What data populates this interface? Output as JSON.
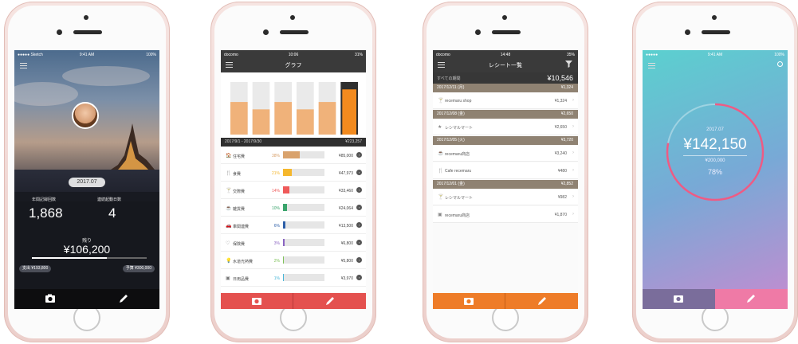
{
  "phones": [
    {
      "status": {
        "carrier": "●●●●● Sketch",
        "time": "9:41 AM",
        "battery": "100%"
      },
      "date": "2017.07",
      "stat_labels": [
        "年間記録回数",
        "連続起動日数"
      ],
      "stat_values": [
        "1,868",
        "4"
      ],
      "remaining_label": "残り",
      "remaining_value": "¥106,200",
      "spend_progress": 0.65,
      "spent_chip": "支出 ¥193,800",
      "budget_chip": "予算 ¥300,000"
    },
    {
      "status": {
        "carrier": "docomo",
        "time": "10:06",
        "battery": "31%"
      },
      "title": "グラフ",
      "bar_levels": [
        0.62,
        0.48,
        0.62,
        0.48,
        0.62,
        0.86
      ],
      "range_label": "2017/9/1 - 2017/9/30",
      "range_total": "¥223,257",
      "categories": [
        {
          "icon": "🏠",
          "name": "住宅費",
          "pct": "38%",
          "ratio": 0.38,
          "color": "#d9a26c",
          "amount": "¥85,000"
        },
        {
          "icon": "🍴",
          "name": "食費",
          "pct": "21%",
          "ratio": 0.21,
          "color": "#f5b72d",
          "amount": "¥47,973"
        },
        {
          "icon": "🍸",
          "name": "交際費",
          "pct": "14%",
          "ratio": 0.14,
          "color": "#ef5a5a",
          "amount": "¥33,460"
        },
        {
          "icon": "☕",
          "name": "雑貨費",
          "pct": "10%",
          "ratio": 0.1,
          "color": "#3aa46c",
          "amount": "¥24,064"
        },
        {
          "icon": "🚗",
          "name": "車関連費",
          "pct": "6%",
          "ratio": 0.06,
          "color": "#2e5fa8",
          "amount": "¥13,500"
        },
        {
          "icon": "♡",
          "name": "保険費",
          "pct": "3%",
          "ratio": 0.03,
          "color": "#8a64c2",
          "amount": "¥6,800"
        },
        {
          "icon": "💡",
          "name": "水道光熱費",
          "pct": "2%",
          "ratio": 0.02,
          "color": "#7fc25a",
          "amount": "¥5,800"
        },
        {
          "icon": "▣",
          "name": "日用品費",
          "pct": "1%",
          "ratio": 0.01,
          "color": "#48b6d8",
          "amount": "¥3,970"
        }
      ]
    },
    {
      "status": {
        "carrier": "docomo",
        "time": "14:48",
        "battery": "35%"
      },
      "title": "レシート一覧",
      "total_label": "すべての期間",
      "total_value": "¥10,546",
      "groups": [
        {
          "date": "2017/12/11 (月)",
          "sum": "¥1,324",
          "items": [
            {
              "icon": "🍸",
              "name": "recemaru shop",
              "amount": "¥1,324"
            }
          ]
        },
        {
          "date": "2017/12/08 (金)",
          "sum": "¥2,650",
          "items": [
            {
              "icon": "★",
              "name": "レシマルマート",
              "amount": "¥2,650"
            }
          ]
        },
        {
          "date": "2017/12/05 (火)",
          "sum": "¥3,720",
          "items": [
            {
              "icon": "☕",
              "name": "recemaru商店",
              "amount": "¥3,240"
            },
            {
              "icon": "🍴",
              "name": "Cafe recemaru",
              "amount": "¥480"
            }
          ]
        },
        {
          "date": "2017/12/01 (金)",
          "sum": "¥2,852",
          "items": [
            {
              "icon": "🍸",
              "name": "レシマルマート",
              "amount": "¥982"
            },
            {
              "icon": "▣",
              "name": "recemaru商店",
              "amount": "¥1,870"
            }
          ]
        }
      ]
    },
    {
      "status": {
        "carrier": "●●●●●",
        "time": "9:41 AM",
        "battery": "100%"
      },
      "month": "2017.07",
      "amount": "¥142,150",
      "budget": "¥200,000",
      "percent": "78%",
      "ratio": 0.78
    }
  ],
  "colors": {
    "graph_tab": "#e4514f",
    "receipt_tab": "#ee7c28",
    "ring_progress": "#ee5b84"
  }
}
